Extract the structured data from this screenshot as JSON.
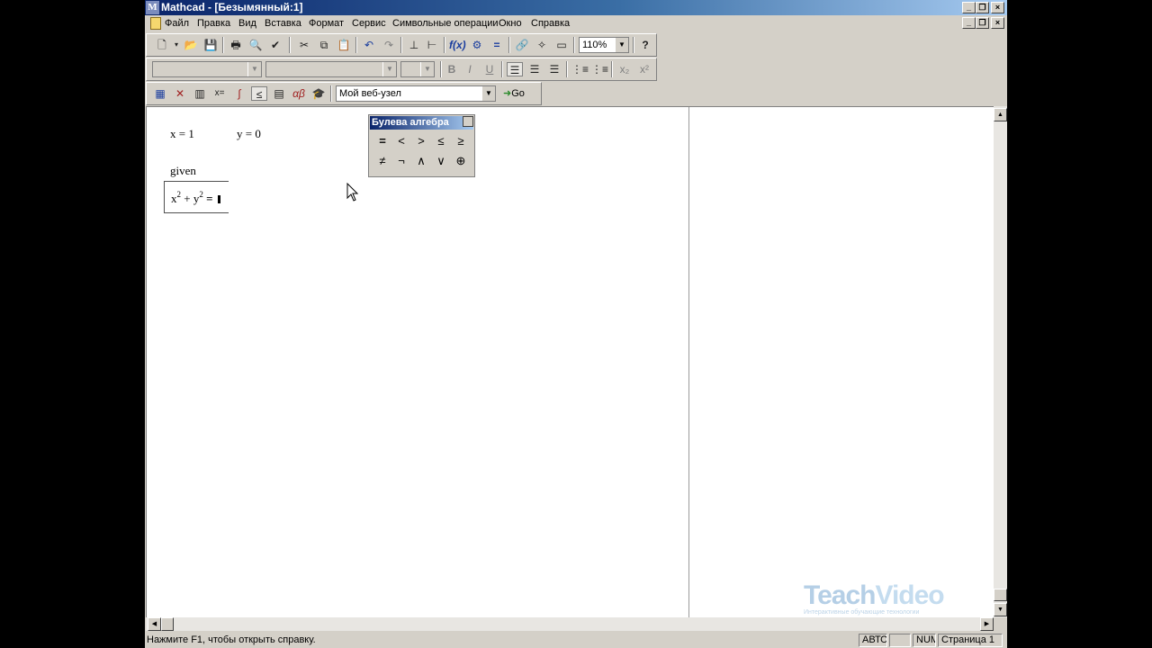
{
  "window": {
    "title": "Mathcad - [Безымянный:1]",
    "app_icon": "M"
  },
  "menu": [
    "Файл",
    "Правка",
    "Вид",
    "Вставка",
    "Формат",
    "Сервис",
    "Символьные операции",
    "Окно",
    "Справка"
  ],
  "standard_toolbar": {
    "zoom": "110%",
    "icons": [
      "new-icon",
      "open-icon",
      "save-icon",
      "print-icon",
      "print-preview-icon",
      "spell-check-icon",
      "cut-icon",
      "copy-icon",
      "paste-icon",
      "undo-icon",
      "redo-icon",
      "align-horizontal-icon",
      "align-vertical-icon",
      "insert-function-icon",
      "insert-unit-icon",
      "calculate-icon",
      "insert-hyperlink-icon",
      "component-wizard-icon",
      "insert-region-icon",
      "help-icon"
    ]
  },
  "formatting_toolbar": {
    "style": "",
    "font": "",
    "size": "",
    "bold": "B",
    "italic": "I",
    "underline": "U"
  },
  "math_toolbar": {
    "web_url": "Мой веб-узел",
    "go": "Go"
  },
  "worksheet": {
    "x_def": "x = 1",
    "y_def": "y = 0",
    "given": "given",
    "eq_x": "x",
    "eq_x_exp": "2",
    "eq_plus": "+ y",
    "eq_y_exp": "2",
    "eq_eq": "="
  },
  "boolean_palette": {
    "title": "Булева алгебра",
    "buttons": [
      "=",
      "<",
      ">",
      "≤",
      "≥",
      "≠",
      "¬",
      "∧",
      "∨",
      "⊕"
    ]
  },
  "status": {
    "hint": "Нажмите F1, чтобы открыть справку.",
    "mode": "АВТО",
    "num": "NUM",
    "page": "Страница 1"
  },
  "watermark": {
    "brand_teach": "Teach",
    "brand_video": "Video",
    "tagline": "Интерактивные обучающие технологии"
  }
}
